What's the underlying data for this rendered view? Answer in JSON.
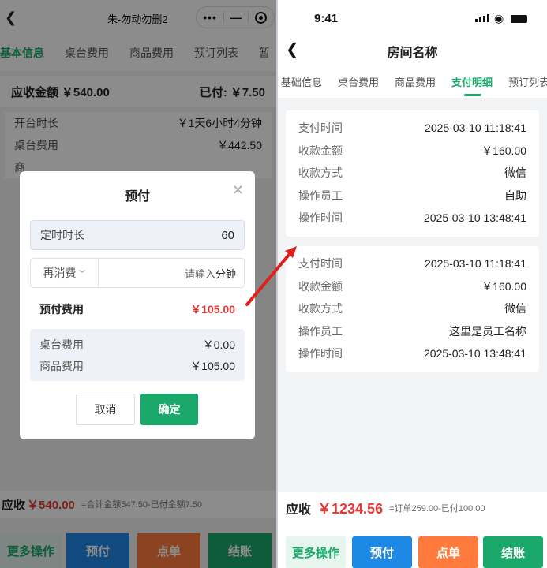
{
  "left": {
    "app_title": "朱-勿动勿删2",
    "tabs": [
      "基本信息",
      "桌台费用",
      "商品费用",
      "预订列表",
      "暂"
    ],
    "receivable_label": "应收金额",
    "receivable_amount": "￥540.00",
    "paid_label": "已付:",
    "paid_amount": "￥7.50",
    "info_rows": [
      {
        "label": "开台时长",
        "value": "￥1天6小时4分钟"
      },
      {
        "label": "桌台费用",
        "value": "￥442.50"
      },
      {
        "label": "商",
        "value": ""
      }
    ],
    "bottom": {
      "label": "应收",
      "amount": "￥540.00",
      "detail": "=合计金额547.50-已付金额7.50"
    },
    "actions": [
      "更多操作",
      "预付",
      "点单",
      "结账"
    ]
  },
  "modal": {
    "title": "预付",
    "timer_label": "定时时长",
    "timer_value": "60",
    "consume_select": "再消费",
    "consume_placeholder": "请输入",
    "consume_unit": "分钟",
    "prepay_label": "预付费用",
    "prepay_amount": "￥105.00",
    "breakdown": [
      {
        "label": "桌台费用",
        "value": "￥0.00"
      },
      {
        "label": "商品费用",
        "value": "￥105.00"
      }
    ],
    "cancel_label": "取消",
    "confirm_label": "确定"
  },
  "right": {
    "status_time": "9:41",
    "nav_title": "房间名称",
    "tabs": [
      "基础信息",
      "桌台费用",
      "商品费用",
      "支付明细",
      "预订列表"
    ],
    "active_tab": "支付明细",
    "cards": [
      {
        "rows": [
          {
            "label": "支付时间",
            "value": "2025-03-10 11:18:41"
          },
          {
            "label": "收款金额",
            "value": "￥160.00"
          },
          {
            "label": "收款方式",
            "value": "微信"
          },
          {
            "label": "操作员工",
            "value": "自助"
          },
          {
            "label": "操作时间",
            "value": "2025-03-10 13:48:41"
          }
        ]
      },
      {
        "rows": [
          {
            "label": "支付时间",
            "value": "2025-03-10 11:18:41"
          },
          {
            "label": "收款金额",
            "value": "￥160.00"
          },
          {
            "label": "收款方式",
            "value": "微信"
          },
          {
            "label": "操作员工",
            "value": "这里是员工名称"
          },
          {
            "label": "操作时间",
            "value": "2025-03-10 13:48:41"
          }
        ]
      }
    ],
    "total": {
      "label": "应收",
      "amount": "￥1234.56",
      "detail": "=订单259.00-已付100.00"
    },
    "actions": [
      "更多操作",
      "预付",
      "点单",
      "结账"
    ]
  },
  "colors": {
    "accent_green": "#1aa86b",
    "red": "#e53935",
    "gold": "#e6a000",
    "blue": "#1e88e5",
    "orange": "#ff7a3d"
  }
}
